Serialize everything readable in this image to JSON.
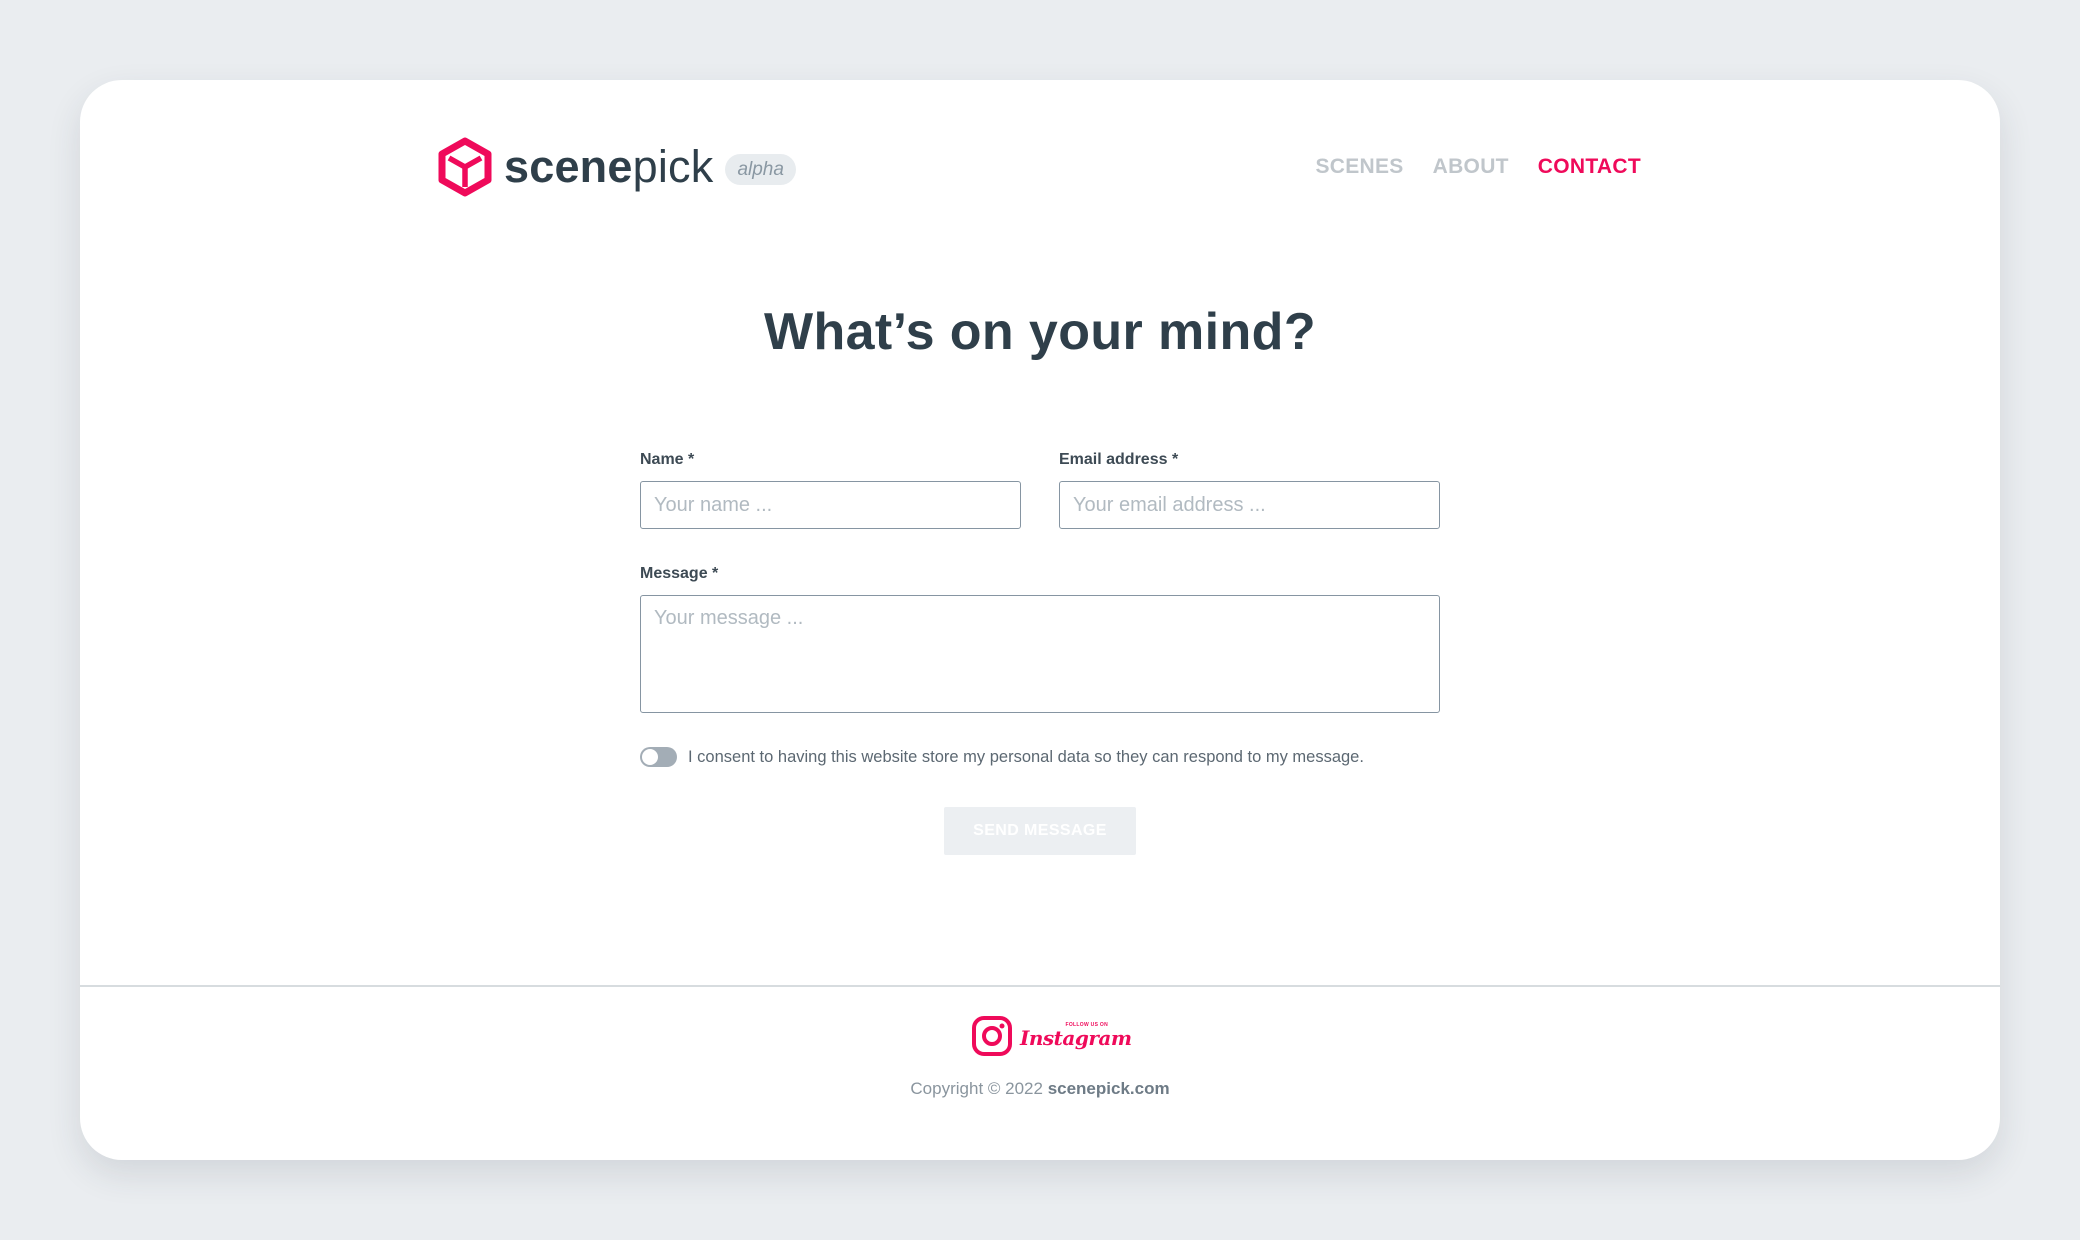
{
  "header": {
    "logo": {
      "text_bold": "scene",
      "text_light": "pick",
      "badge": "alpha"
    },
    "nav": [
      {
        "label": "SCENES",
        "active": false
      },
      {
        "label": "ABOUT",
        "active": false
      },
      {
        "label": "CONTACT",
        "active": true
      }
    ]
  },
  "main": {
    "title": "What’s on your mind?",
    "form": {
      "name": {
        "label": "Name *",
        "placeholder": "Your name ...",
        "value": ""
      },
      "email": {
        "label": "Email address *",
        "placeholder": "Your email address ...",
        "value": ""
      },
      "message": {
        "label": "Message *",
        "placeholder": "Your message ...",
        "value": ""
      },
      "consent": {
        "text": "I consent to having this website store my personal data so they can respond to my message.",
        "checked": false
      },
      "send_label": "SEND MESSAGE"
    }
  },
  "footer": {
    "instagram": {
      "follow": "FOLLOW US ON",
      "name": "Instagram",
      "icon": "instagram-icon"
    },
    "copyright_prefix": "Copyright © 2022",
    "copyright_site": "scenepick.com"
  },
  "colors": {
    "brand": "#ef0a5a",
    "text_dark": "#2f3f4a",
    "nav_inactive": "#c0c6cb",
    "page_bg": "#eaedf0"
  }
}
